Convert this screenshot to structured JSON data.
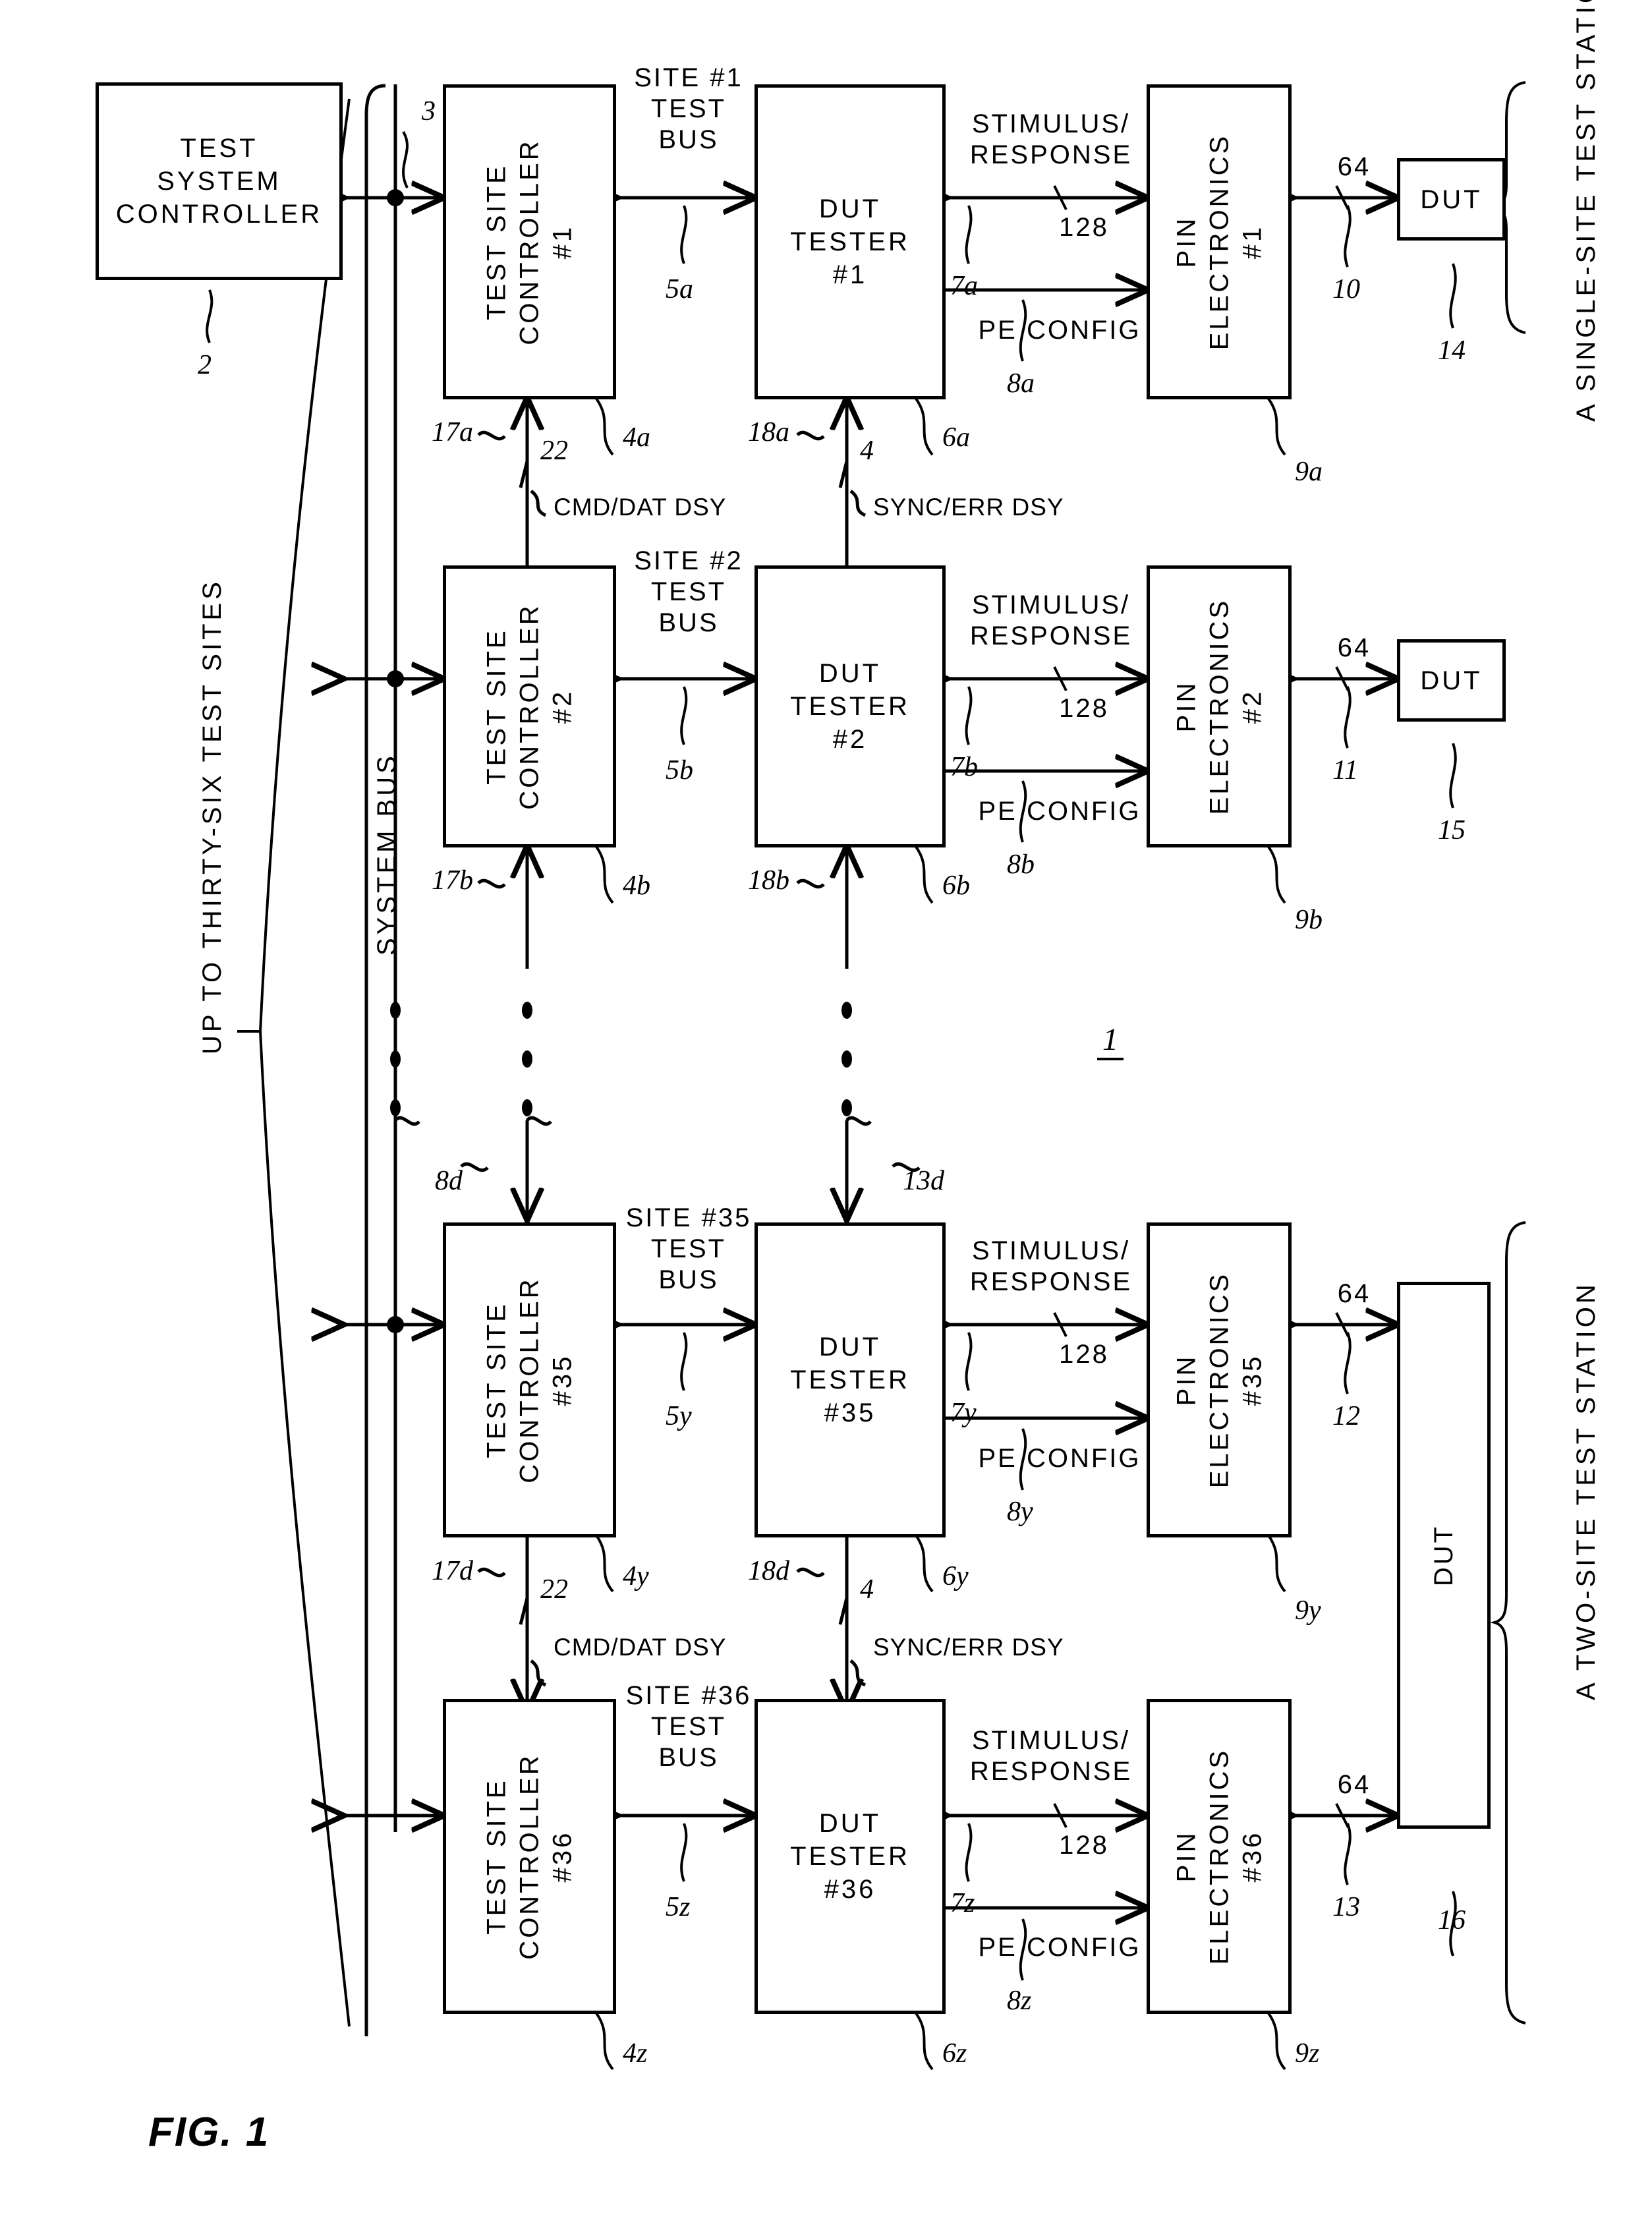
{
  "figure": {
    "label": "FIG. 1",
    "number_ref": "1"
  },
  "system_controller": {
    "title": "TEST\nSYSTEM\nCONTROLLER",
    "ref": "2"
  },
  "system_bus": {
    "label": "SYSTEM BUS",
    "ref": "3"
  },
  "left_note": "UP TO THIRTY-SIX TEST SITES",
  "stations": [
    {
      "name": "A SINGLE-SITE TEST STATION"
    },
    {
      "name": "A TWO-SITE TEST STATION"
    }
  ],
  "daisy_chains": [
    {
      "cmd": "CMD/DAT DSY",
      "cmd_ref": "22",
      "sync": "SYNC/ERR DSY",
      "sync_ref": "4"
    },
    {
      "cmd": "CMD/DAT DSY",
      "cmd_ref": "22",
      "sync": "SYNC/ERR DSY",
      "sync_ref": "4"
    }
  ],
  "rows": [
    {
      "site_controller": {
        "title": "TEST SITE\nCONTROLLER\n#1",
        "ref": "4a"
      },
      "site_bus": {
        "label": "SITE #1\nTEST\nBUS",
        "ref": "5a"
      },
      "dut_tester": {
        "title": "DUT\nTESTER\n#1",
        "ref": "6a"
      },
      "stimulus": {
        "label": "STIMULUS/\nRESPONSE",
        "width": "128",
        "ref": "7a"
      },
      "pe_config": {
        "label": "PE CONFIG",
        "ref": "8a"
      },
      "pin_electronics": {
        "title": "PIN\nELECTRONICS\n#1",
        "ref": "9a"
      },
      "dut_link": {
        "width": "64",
        "ref": "10"
      },
      "dut": {
        "title": "DUT",
        "ref": "14"
      },
      "cmd_in_ref": "17a",
      "sync_in_ref": "18a"
    },
    {
      "site_controller": {
        "title": "TEST SITE\nCONTROLLER\n#2",
        "ref": "4b"
      },
      "site_bus": {
        "label": "SITE #2\nTEST\nBUS",
        "ref": "5b"
      },
      "dut_tester": {
        "title": "DUT\nTESTER\n#2",
        "ref": "6b"
      },
      "stimulus": {
        "label": "STIMULUS/\nRESPONSE",
        "width": "128",
        "ref": "7b"
      },
      "pe_config": {
        "label": "PE CONFIG",
        "ref": "8b"
      },
      "pin_electronics": {
        "title": "PIN\nELECTRONICS\n#2",
        "ref": "9b"
      },
      "dut_link": {
        "width": "64",
        "ref": "11"
      },
      "dut": {
        "title": "DUT",
        "ref": "15"
      },
      "cmd_in_ref": "17b",
      "sync_in_ref": "18b"
    },
    {
      "site_controller": {
        "title": "TEST SITE\nCONTROLLER\n#35",
        "ref": "4y"
      },
      "site_bus": {
        "label": "SITE #35\nTEST\nBUS",
        "ref": "5y"
      },
      "dut_tester": {
        "title": "DUT\nTESTER\n#35",
        "ref": "6y"
      },
      "stimulus": {
        "label": "STIMULUS/\nRESPONSE",
        "width": "128",
        "ref": "7y"
      },
      "pe_config": {
        "label": "PE CONFIG",
        "ref": "8y"
      },
      "pin_electronics": {
        "title": "PIN\nELECTRONICS\n#35",
        "ref": "9y"
      },
      "dut_link": {
        "width": "64",
        "ref": "12"
      },
      "dut": {
        "title": "DUT",
        "ref": "16"
      },
      "cmd_in_ref": "17d",
      "sync_in_ref": "18d"
    },
    {
      "site_controller": {
        "title": "TEST SITE\nCONTROLLER\n#36",
        "ref": "4z"
      },
      "site_bus": {
        "label": "SITE #36\nTEST\nBUS",
        "ref": "5z"
      },
      "dut_tester": {
        "title": "DUT\nTESTER\n#36",
        "ref": "6z"
      },
      "stimulus": {
        "label": "STIMULUS/\nRESPONSE",
        "width": "128",
        "ref": "7z"
      },
      "pe_config": {
        "label": "PE CONFIG",
        "ref": "8z"
      },
      "pin_electronics": {
        "title": "PIN\nELECTRONICS\n#36",
        "ref": "9z"
      },
      "dut_link": {
        "width": "64",
        "ref": "13"
      },
      "dut": {
        "title": "DUT",
        "ref": "16"
      },
      "cmd_in_ref": "",
      "sync_in_ref": ""
    }
  ],
  "ellipsis_refs": {
    "controller": "8d",
    "tester": "13d"
  }
}
